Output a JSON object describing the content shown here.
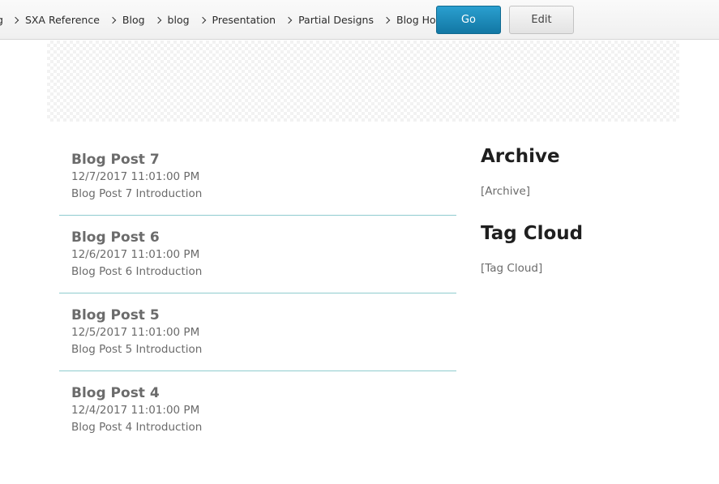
{
  "breadcrumb": {
    "lead": "g",
    "items": [
      "SXA Reference",
      "Blog",
      "blog",
      "Presentation",
      "Partial Designs",
      "Blog Home"
    ]
  },
  "toolbar": {
    "go_label": "Go",
    "edit_label": "Edit"
  },
  "posts": [
    {
      "title": "Blog Post 7",
      "date": "12/7/2017 11:01:00 PM",
      "intro": "Blog Post 7 Introduction"
    },
    {
      "title": "Blog Post 6",
      "date": "12/6/2017 11:01:00 PM",
      "intro": "Blog Post 6 Introduction"
    },
    {
      "title": "Blog Post 5",
      "date": "12/5/2017 11:01:00 PM",
      "intro": "Blog Post 5 Introduction"
    },
    {
      "title": "Blog Post 4",
      "date": "12/4/2017 11:01:00 PM",
      "intro": "Blog Post 4 Introduction"
    }
  ],
  "sidebar": {
    "archive_title": "Archive",
    "archive_placeholder": "[Archive]",
    "tagcloud_title": "Tag Cloud",
    "tagcloud_placeholder": "[Tag Cloud]"
  },
  "colors": {
    "go_button": "#1b88b8",
    "divider": "#8fcccf",
    "post_text": "#6b6b6b"
  }
}
